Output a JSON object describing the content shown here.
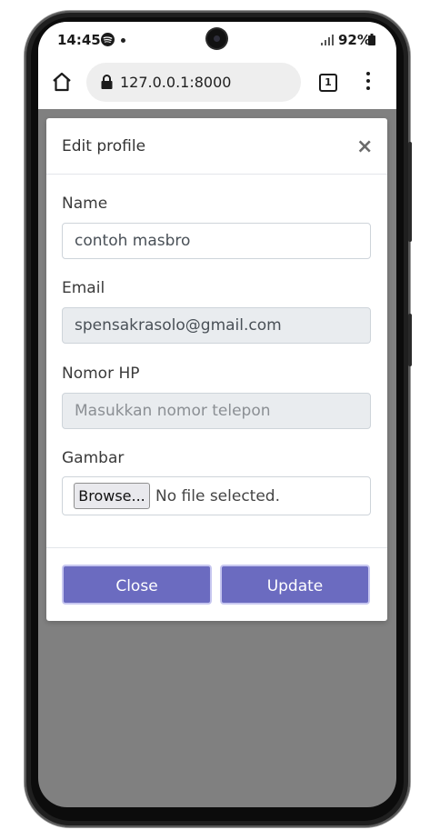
{
  "status_bar": {
    "time": "14:45",
    "battery": "92%"
  },
  "browser": {
    "url": "127.0.0.1:8000",
    "tab_count": "1"
  },
  "modal": {
    "title": "Edit profile",
    "close_symbol": "×",
    "fields": {
      "name": {
        "label": "Name",
        "value": "contoh masbro"
      },
      "email": {
        "label": "Email",
        "value": "spensakrasolo@gmail.com"
      },
      "phone": {
        "label": "Nomor HP",
        "placeholder": "Masukkan nomor telepon"
      },
      "image": {
        "label": "Gambar",
        "button_label": "Browse...",
        "status": "No file selected."
      }
    },
    "buttons": {
      "close": "Close",
      "update": "Update"
    }
  },
  "colors": {
    "accent": "#6b6bc0",
    "backdrop": "#808080"
  },
  "icons": [
    "spotify-icon",
    "signal-icon",
    "battery-icon",
    "home-icon",
    "lock-icon",
    "tabs-icon",
    "menu-icon",
    "close-icon"
  ]
}
